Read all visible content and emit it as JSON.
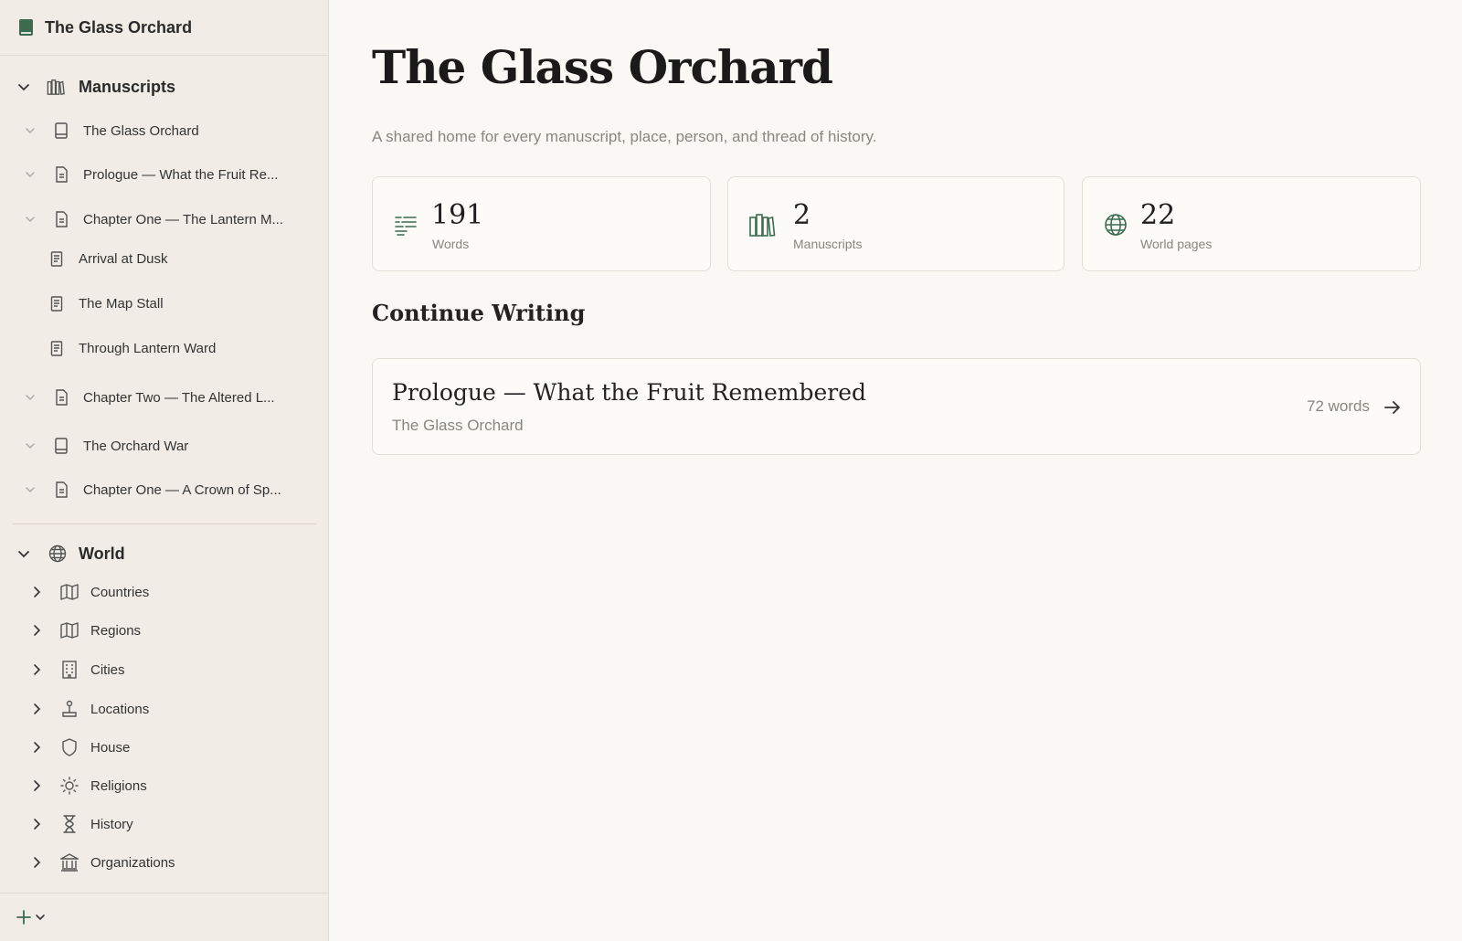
{
  "sidebar": {
    "workspace_title": "The Glass Orchard",
    "manuscripts_label": "Manuscripts",
    "manuscripts": {
      "book1": "The Glass Orchard",
      "prologue": "Prologue — What the Fruit Re...",
      "chapter1": "Chapter One — The Lantern M...",
      "scene1": "Arrival at Dusk",
      "scene2": "The Map Stall",
      "scene3": "Through Lantern Ward",
      "chapter2": "Chapter Two — The Altered L...",
      "book2": "The Orchard War",
      "book2_chapter1": "Chapter One — A Crown of Sp..."
    },
    "world_label": "World",
    "world": {
      "countries": "Countries",
      "regions": "Regions",
      "cities": "Cities",
      "locations": "Locations",
      "house": "House",
      "religions": "Religions",
      "history": "History",
      "organizations": "Organizations"
    }
  },
  "main": {
    "title": "The Glass Orchard",
    "subtitle": "A shared home for every manuscript, place, person, and thread of history.",
    "stats": {
      "words": {
        "value": "191",
        "label": "Words"
      },
      "manuscripts": {
        "value": "2",
        "label": "Manuscripts"
      },
      "world_pages": {
        "value": "22",
        "label": "World pages"
      }
    },
    "continue_heading": "Continue Writing",
    "continue_card": {
      "title": "Prologue — What the Fruit Remembered",
      "book": "The Glass Orchard",
      "words": "72 words"
    }
  },
  "colors": {
    "accent": "#3d6b4f",
    "sidebar_bg": "#f1ede6",
    "page_bg": "#faf8f4",
    "muted_text": "#8a8580"
  }
}
